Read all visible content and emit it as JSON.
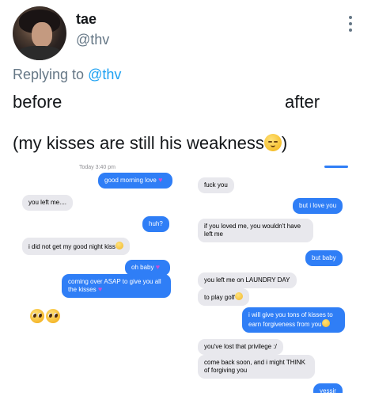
{
  "author": {
    "display_name": "tae",
    "handle": "@thv"
  },
  "reply": {
    "prefix": "Replying to",
    "to": "@thv"
  },
  "tweet": {
    "before": "before",
    "after": "after",
    "caption": "(my kisses are still his weakness",
    "caption_end": ")"
  },
  "left_chat": {
    "timestamp": "Today 3:40 pm",
    "messages": [
      {
        "from": "me",
        "text": "good morning love"
      },
      {
        "from": "them",
        "text": "you left me...."
      },
      {
        "from": "me",
        "text": "huh?"
      },
      {
        "from": "them",
        "text": "i did not get my good night kiss"
      },
      {
        "from": "me",
        "text": "oh baby"
      },
      {
        "from": "me",
        "text": "coming over ASAP to give you all the kisses"
      }
    ]
  },
  "right_chat": {
    "messages": [
      {
        "from": "them",
        "text": "fuck you"
      },
      {
        "from": "me",
        "text": "but i love you"
      },
      {
        "from": "them",
        "text": "if you loved me, you wouldn't have left me"
      },
      {
        "from": "me",
        "text": "but baby"
      },
      {
        "from": "them",
        "text": "you left me on LAUNDRY DAY"
      },
      {
        "from": "them",
        "text": "to play golf"
      },
      {
        "from": "me",
        "text": "i will give you tons of kisses to earn forgiveness from you"
      },
      {
        "from": "them",
        "text": "you've lost that privilege :/"
      },
      {
        "from": "them",
        "text": "come back soon, and i might THINK of forgiving you"
      },
      {
        "from": "me",
        "text": "yessir"
      }
    ]
  },
  "colors": {
    "link": "#1da1f2",
    "imessage_blue": "#2f7ef6",
    "bubble_gray": "#e8e8ed",
    "muted": "#657786"
  },
  "icons": [
    "more-vertical-icon",
    "relieved-face-emoji",
    "pleading-face-emoji",
    "purple-heart-emoji"
  ]
}
